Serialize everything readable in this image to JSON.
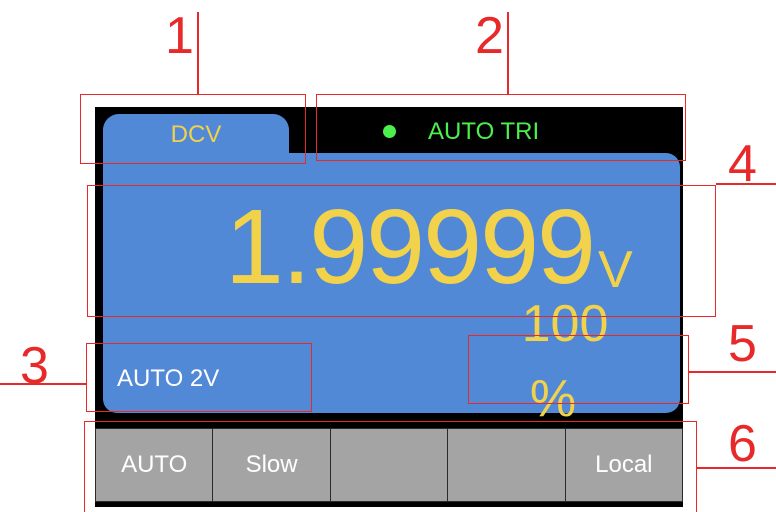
{
  "display": {
    "function_tab": "DCV",
    "trigger_mode": "AUTO TRI",
    "reading": "1.99999",
    "unit": "V",
    "range": "AUTO 2V",
    "percent_value": "100",
    "percent_sign": "%"
  },
  "softkeys": [
    "AUTO",
    "Slow",
    "",
    "",
    "Local"
  ],
  "callouts": [
    "1",
    "2",
    "3",
    "4",
    "5",
    "6"
  ],
  "colors": {
    "panel": "#5189d6",
    "reading": "#f2d24a",
    "trigger": "#4cf04c",
    "softkey": "#a4a4a4",
    "annotation": "#e8292a"
  }
}
